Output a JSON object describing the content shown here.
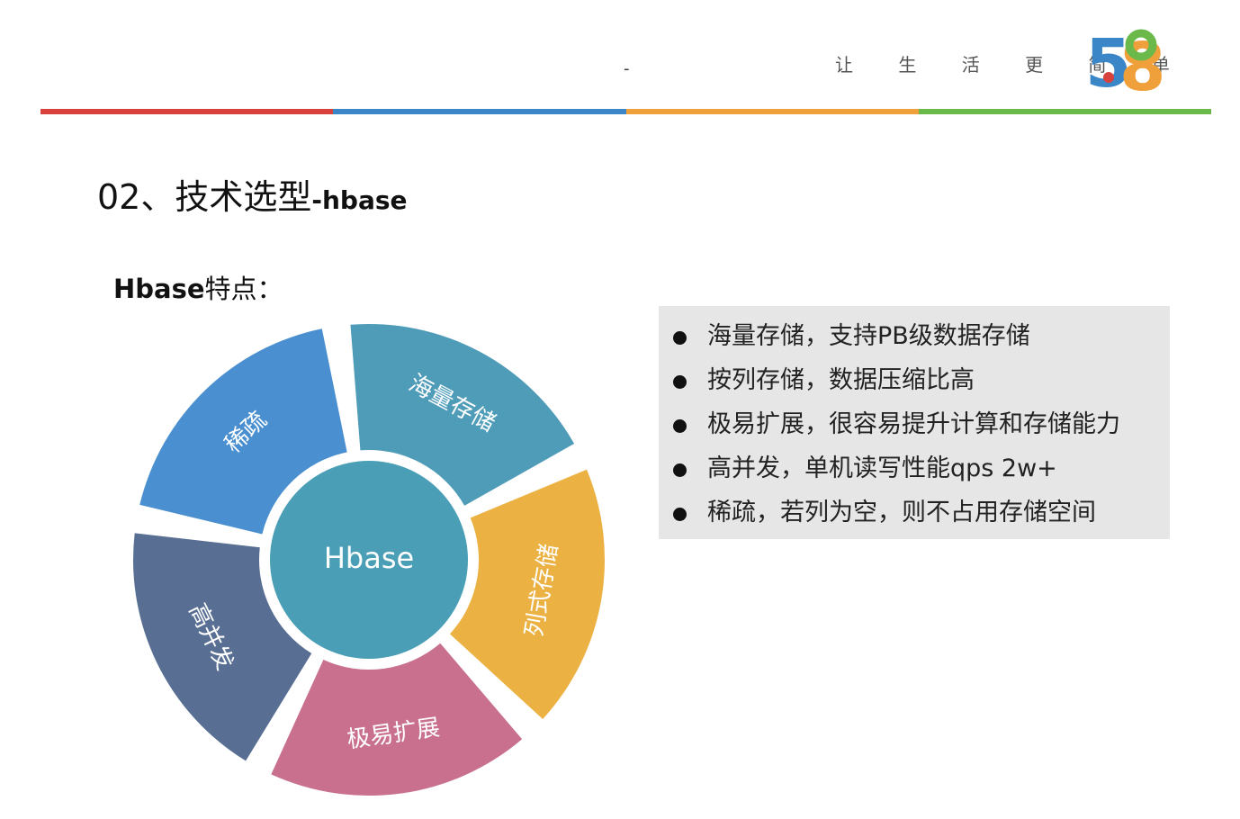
{
  "header": {
    "tagline": "让 生 活 更 简 单",
    "logo_text": "58",
    "dash": "-",
    "bar_colors": [
      "#d9413d",
      "#3b86c6",
      "#f0a03a",
      "#6ab94a"
    ]
  },
  "title": {
    "main": "02、技术选型",
    "sub": "-hbase"
  },
  "subtitle": {
    "en": "Hbase",
    "cn": "特点："
  },
  "wheel": {
    "center_label": "Hbase",
    "center_color": "#4a9fb6",
    "segments": [
      {
        "label": "海量存储",
        "color": "#4f9cb9"
      },
      {
        "label": "列式存储",
        "color": "#ebb243"
      },
      {
        "label": "极易扩展",
        "color": "#c8708e"
      },
      {
        "label": "高并发",
        "color": "#586f93"
      },
      {
        "label": "稀疏",
        "color": "#4a8fcf"
      }
    ]
  },
  "features": [
    "海量存储，支持PB级数据存储",
    "按列存储，数据压缩比高",
    "极易扩展，很容易提升计算和存储能力",
    "高并发，单机读写性能qps 2w+",
    "稀疏，若列为空，则不占用存储空间"
  ]
}
